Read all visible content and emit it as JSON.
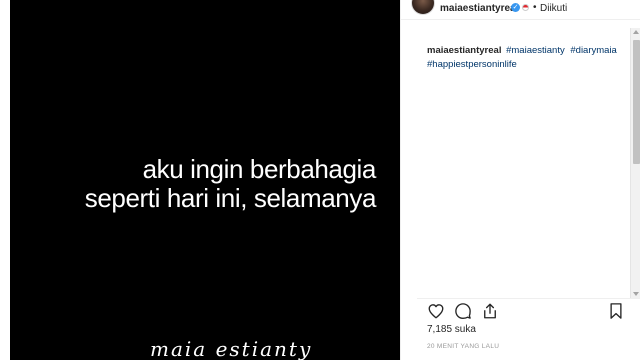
{
  "post": {
    "quote_line1": "aku ingin berbahagia",
    "quote_line2": "seperti hari ini, selamanya",
    "signature": "maia estianty"
  },
  "header": {
    "username": "maiaestiantyreal",
    "dot": "•",
    "follow_status": "Diikuti",
    "verified_icon": "verified-check-icon",
    "flag_icon": "indonesia-flag-icon"
  },
  "caption": {
    "username": "maiaestiantyreal",
    "hashtags": [
      "#maiaestianty",
      "#diarymaia",
      "#happiestpersoninlife"
    ]
  },
  "actions": {
    "icons": [
      "heart-icon",
      "comment-icon",
      "share-icon",
      "bookmark-icon"
    ]
  },
  "likes_text": "7,185 suka",
  "time_ago": "20 MENIT YANG LALU",
  "colors": {
    "image_bg": "#000000",
    "link": "#003569",
    "verified": "#3897f0",
    "muted": "#999999"
  }
}
